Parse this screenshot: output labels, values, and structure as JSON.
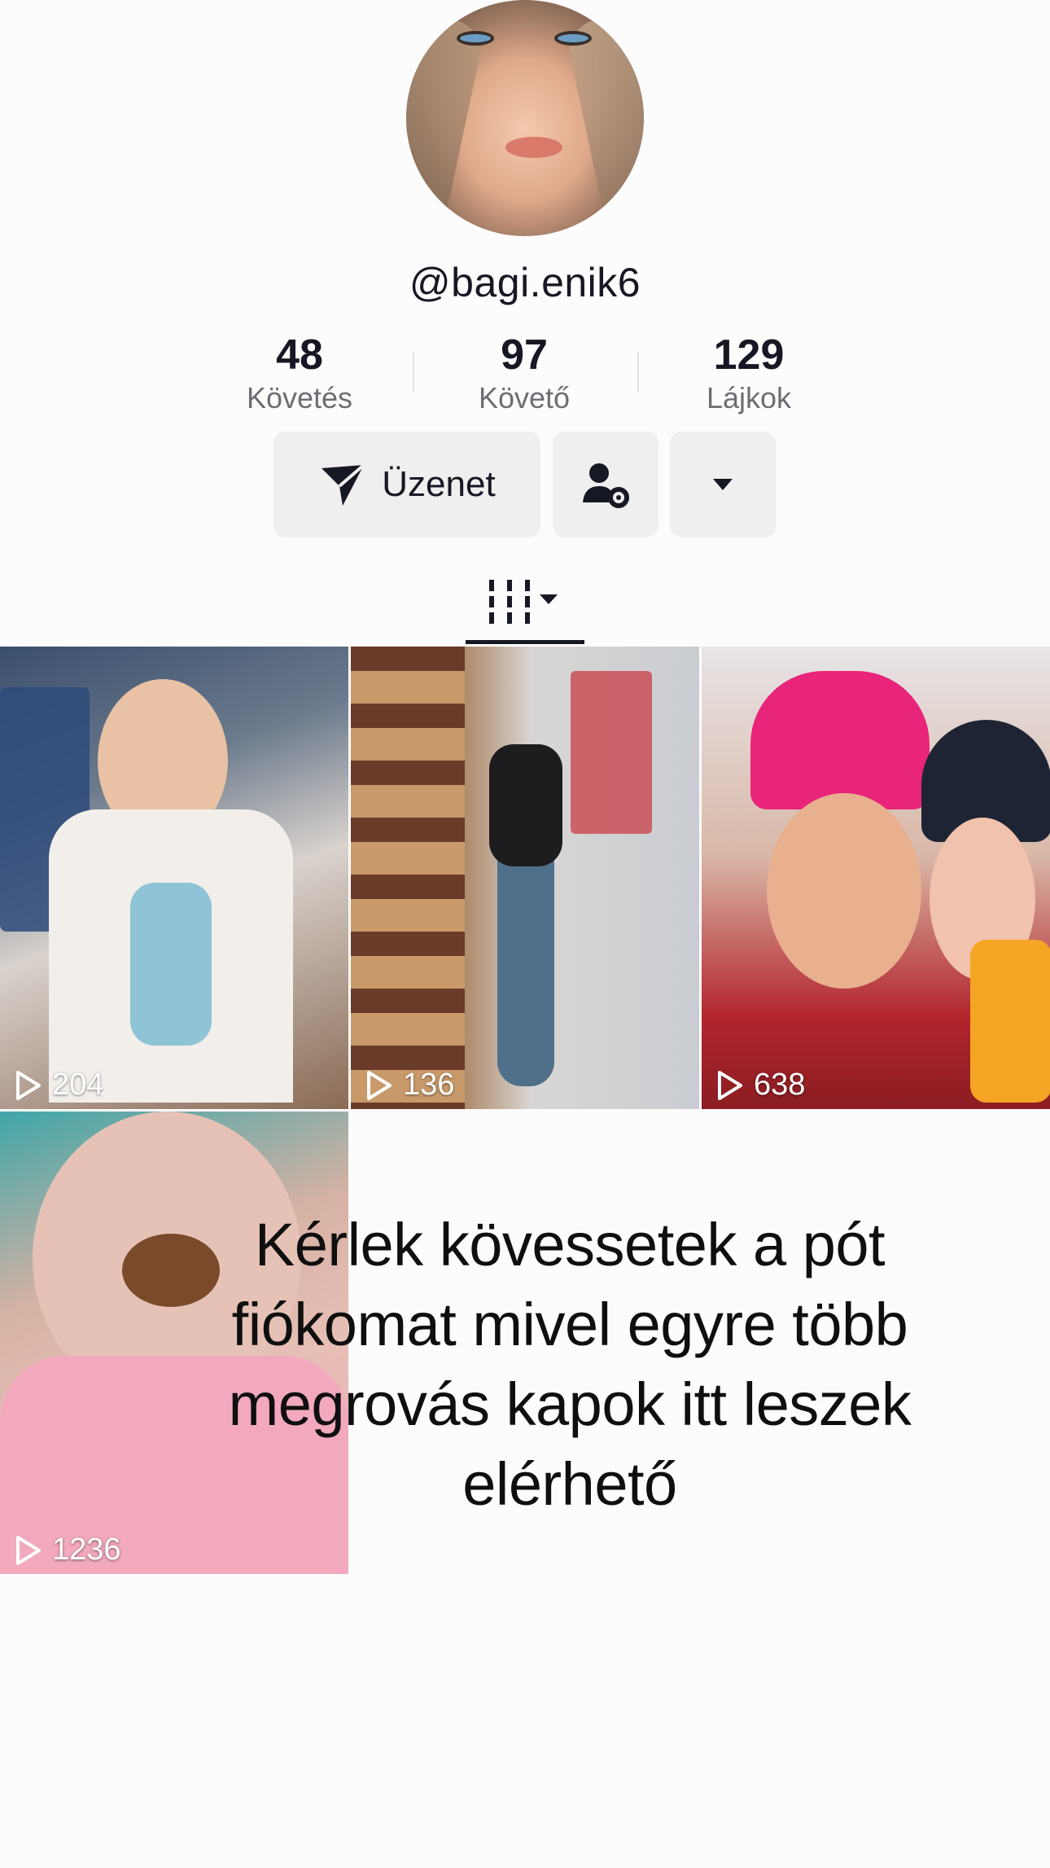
{
  "profile": {
    "username": "@bagi.enik6"
  },
  "stats": [
    {
      "value": "48",
      "label": "Követés"
    },
    {
      "value": "97",
      "label": "Követő"
    },
    {
      "value": "129",
      "label": "Lájkok"
    }
  ],
  "actions": {
    "message_label": "Üzenet",
    "message_icon": "send-icon",
    "follow_icon": "user-settings-icon",
    "more_icon": "caret-down-icon"
  },
  "tabs": {
    "active_icon": "videos-grid-icon"
  },
  "videos": [
    {
      "views": "204"
    },
    {
      "views": "136"
    },
    {
      "views": "638"
    },
    {
      "views": "1236"
    }
  ],
  "overlay": {
    "lines": [
      "Kérlek kövessetek a pót",
      "fiókomat mivel egyre több",
      "megrovás kapok itt leszek",
      "elérhető"
    ]
  },
  "colors": {
    "text": "#161823",
    "secondary_text": "#6d6e74",
    "button_bg": "#efefef"
  }
}
